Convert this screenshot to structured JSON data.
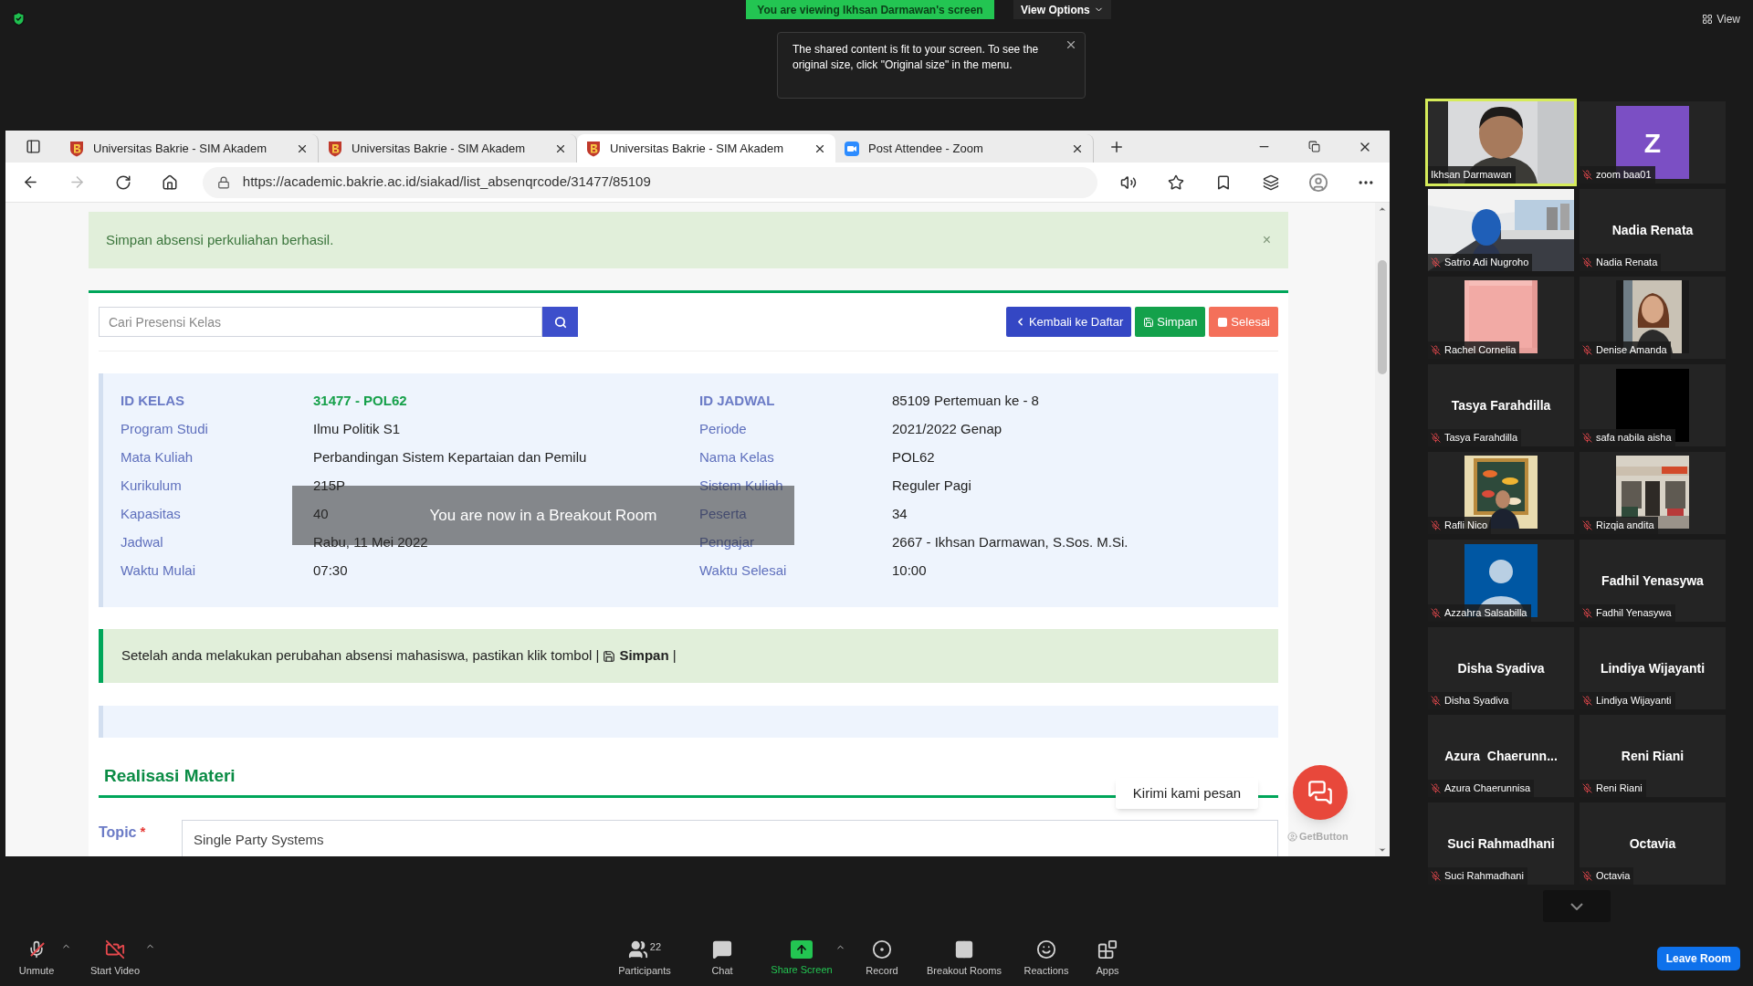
{
  "share_banner": {
    "text": "You are viewing Ikhsan Darmawan's screen"
  },
  "view_options": {
    "label": "View Options"
  },
  "view_button": {
    "label": "View"
  },
  "tooltip": {
    "text": "The shared content is fit to your screen. To see the original size, click \"Original size\" in the menu."
  },
  "browser": {
    "tabs": [
      {
        "title": "Universitas Bakrie - SIM Akadem",
        "kind": "site",
        "selected": false
      },
      {
        "title": "Universitas Bakrie - SIM Akadem",
        "kind": "site",
        "selected": false
      },
      {
        "title": "Universitas Bakrie - SIM Akadem",
        "kind": "site",
        "selected": true
      },
      {
        "title": "Post Attendee - Zoom",
        "kind": "zoom",
        "selected": false
      }
    ],
    "url": "https://academic.bakrie.ac.id/siakad/list_absenqrcode/31477/85109"
  },
  "alert": {
    "text": "Simpan absensi perkuliahan berhasil.",
    "close": "×"
  },
  "search": {
    "placeholder": "Cari Presensi Kelas"
  },
  "actions": [
    {
      "label": "Kembali ke Daftar",
      "kind": "back"
    },
    {
      "label": "Simpan",
      "kind": "save"
    },
    {
      "label": "Selesai",
      "kind": "finish"
    }
  ],
  "class_info": {
    "left": [
      {
        "label": "ID KELAS",
        "value": "31477 - POL62",
        "header": true,
        "highlight": true
      },
      {
        "label": "Program Studi",
        "value": "Ilmu Politik S1",
        "header": false,
        "highlight": false
      },
      {
        "label": "Mata Kuliah",
        "value": "Perbandingan Sistem Kepartaian dan Pemilu",
        "header": false,
        "highlight": false
      },
      {
        "label": "Kurikulum",
        "value": "215P",
        "header": false,
        "highlight": false
      },
      {
        "label": "Kapasitas",
        "value": "40",
        "header": false,
        "highlight": false
      },
      {
        "label": "Jadwal",
        "value": "Rabu, 11 Mei 2022",
        "header": false,
        "highlight": false
      },
      {
        "label": "Waktu Mulai",
        "value": "07:30",
        "header": false,
        "highlight": false
      }
    ],
    "right": [
      {
        "label": "ID JADWAL",
        "value": "85109 Pertemuan ke - 8",
        "header": true,
        "highlight": false
      },
      {
        "label": "Periode",
        "value": "2021/2022 Genap",
        "header": false,
        "highlight": false
      },
      {
        "label": "Nama Kelas",
        "value": "POL62",
        "header": false,
        "highlight": false
      },
      {
        "label": "Sistem Kuliah",
        "value": "Reguler Pagi",
        "header": false,
        "highlight": false
      },
      {
        "label": "Peserta",
        "value": "34",
        "header": false,
        "highlight": false
      },
      {
        "label": "Pengajar",
        "value": "2667 - Ikhsan Darmawan, S.Sos. M.Si.",
        "header": false,
        "highlight": false
      },
      {
        "label": "Waktu Selesai",
        "value": "10:00",
        "header": false,
        "highlight": false
      }
    ]
  },
  "breakout_notice": "You are now in a Breakout Room",
  "notice": {
    "text": "Setelah anda melakukan perubahan absensi mahasiswa, pastikan klik tombol |",
    "button_text": "**Simpan** |"
  },
  "section": {
    "title": "Realisasi Materi"
  },
  "topic": {
    "label": "Topic",
    "required": "*",
    "value": "Single Party Systems"
  },
  "chat_widget": {
    "bubble": "Kirimi kami pesan",
    "credit": "GetButton"
  },
  "gallery": [
    {
      "name": "Ikhsan Darmawan",
      "kind": "picture",
      "muted": false,
      "active": true
    },
    {
      "name": "zoom baa01",
      "kind": "letter",
      "letter": "Z",
      "muted": true,
      "active": false
    },
    {
      "name": "Satrio Adi Nugroho",
      "kind": "picture",
      "muted": true,
      "active": false
    },
    {
      "name": "Nadia Renata",
      "kind": "name",
      "display_name": "Nadia Renata",
      "muted": true,
      "active": false
    },
    {
      "name": "Rachel Cornelia",
      "kind": "picture",
      "muted": true,
      "active": false
    },
    {
      "name": "Denise Amanda",
      "kind": "picture",
      "muted": true,
      "active": false
    },
    {
      "name": "Tasya Farahdilla",
      "kind": "name",
      "display_name": "Tasya Farahdilla",
      "muted": true,
      "active": false
    },
    {
      "name": "safa nabila aisha",
      "kind": "blank",
      "muted": true,
      "active": false
    },
    {
      "name": "Rafli Nico",
      "kind": "picture",
      "muted": true,
      "active": false
    },
    {
      "name": "Rizqia andita",
      "kind": "picture",
      "muted": true,
      "active": false
    },
    {
      "name": "Azzahra Salsabilla",
      "kind": "avatar",
      "muted": true,
      "active": false
    },
    {
      "name": "Fadhil Yenasywa",
      "kind": "name",
      "display_name": "Fadhil Yenasywa",
      "muted": true,
      "active": false
    },
    {
      "name": "Disha Syadiva",
      "kind": "name",
      "display_name": "Disha Syadiva",
      "muted": true,
      "active": false
    },
    {
      "name": "Lindiya Wijayanti",
      "kind": "name",
      "display_name": "Lindiya Wijayanti",
      "muted": true,
      "active": false
    },
    {
      "name": "Azura Chaerunnisa",
      "kind": "name",
      "display_name": "Azura  Chaerunn...",
      "muted": true,
      "active": false
    },
    {
      "name": "Reni Riani",
      "kind": "name",
      "display_name": "Reni Riani",
      "muted": true,
      "active": false
    },
    {
      "name": "Suci Rahmadhani",
      "kind": "name",
      "display_name": "Suci Rahmadhani",
      "muted": true,
      "active": false
    },
    {
      "name": "Octavia",
      "kind": "name",
      "display_name": "Octavia",
      "muted": true,
      "active": false
    }
  ],
  "toolbar": {
    "items": [
      {
        "label": "Unmute",
        "kind": "mic",
        "caret": true
      },
      {
        "label": "Start Video",
        "kind": "video",
        "caret": true
      },
      {
        "label": "Participants",
        "kind": "participants",
        "count": "22",
        "caret": false
      },
      {
        "label": "Chat",
        "kind": "chat",
        "caret": false
      },
      {
        "label": "Share Screen",
        "kind": "share",
        "caret": true
      },
      {
        "label": "Record",
        "kind": "record",
        "caret": false
      },
      {
        "label": "Breakout Rooms",
        "kind": "breakout",
        "caret": false
      },
      {
        "label": "Reactions",
        "kind": "reactions",
        "caret": false
      },
      {
        "label": "Apps",
        "kind": "apps",
        "caret": false
      }
    ],
    "leave": "Leave Room"
  }
}
